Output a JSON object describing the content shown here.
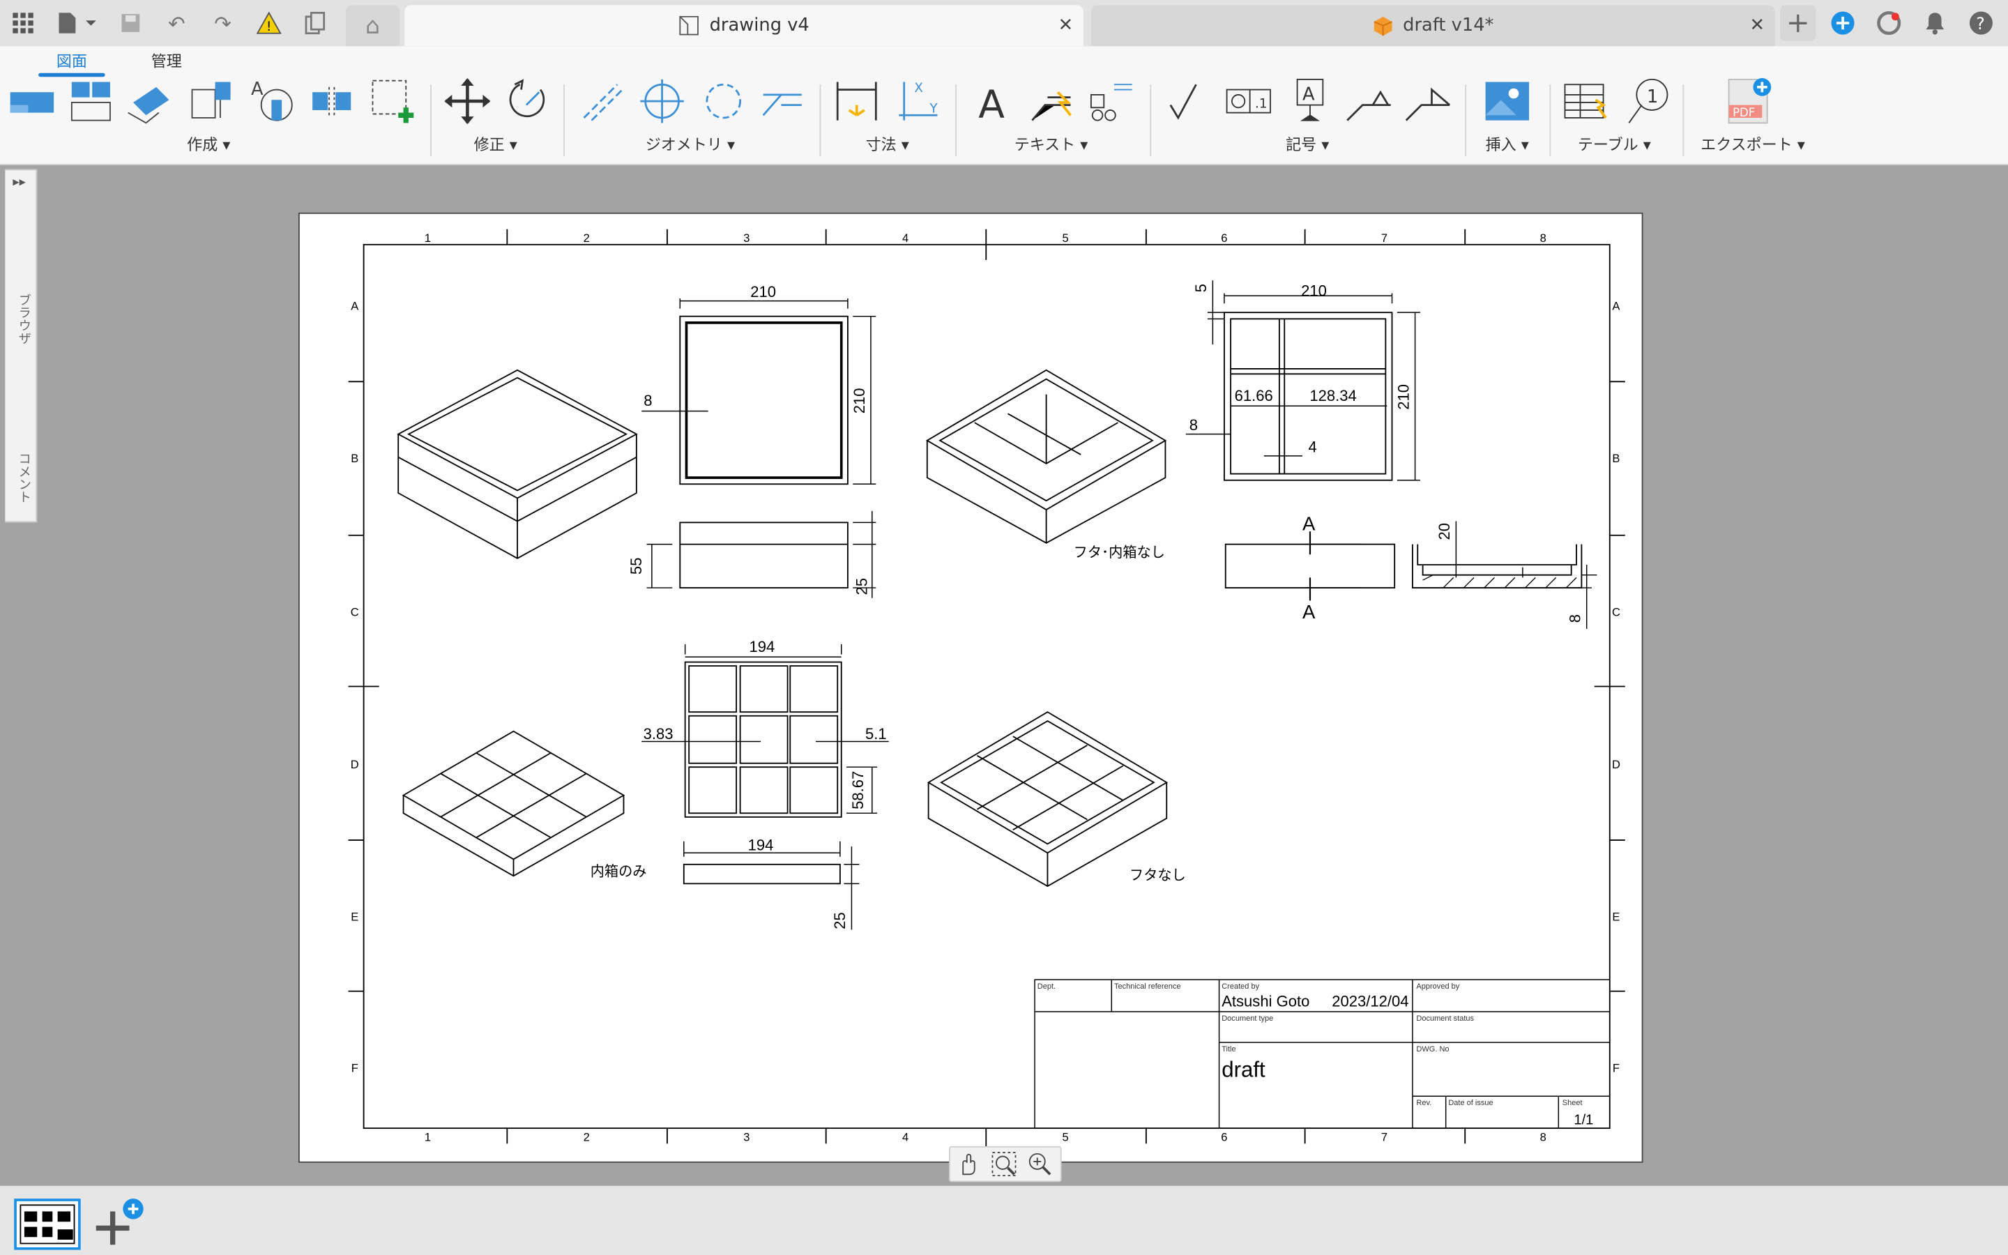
{
  "tabs": [
    {
      "label": "drawing v4",
      "active": true
    },
    {
      "label": "draft v14*",
      "active": false
    }
  ],
  "ribbon": {
    "tabs": [
      "図面",
      "管理"
    ],
    "groups": [
      "作成",
      "修正",
      "ジオメトリ",
      "寸法",
      "テキスト",
      "記号",
      "挿入",
      "テーブル",
      "エクスポート"
    ]
  },
  "browser": {
    "label1": "ブラウザ",
    "label2": "コメント",
    "toggle": "▸▸"
  },
  "sheet": {
    "cols": [
      "1",
      "2",
      "3",
      "4",
      "5",
      "6",
      "7",
      "8"
    ],
    "rows": [
      "A",
      "B",
      "C",
      "D",
      "E",
      "F"
    ],
    "dims": {
      "top_width": "210",
      "top_height": "210",
      "wall": "8",
      "front_h1": "55",
      "front_h2": "25",
      "r_width": "210",
      "r_top": "5",
      "r_height": "210",
      "r_left": "8",
      "r_d1": "61.66",
      "r_d2": "128.34",
      "r_d3": "4",
      "sec_label_top": "A",
      "sec_label_bot": "A",
      "sec_h": "20",
      "sec_w": "8",
      "in_width": "194",
      "in_wall": "3.83",
      "in_gap": "5.1",
      "in_cell": "58.67",
      "in_front_w": "194",
      "in_front_h": "25"
    },
    "labels": {
      "no_lid_inner": "フタ･内箱なし",
      "inner_only": "内箱のみ",
      "no_lid": "フタなし"
    },
    "title_block": {
      "dept": "Dept.",
      "tech_ref": "Technical reference",
      "created_by_lbl": "Created by",
      "approved_by_lbl": "Approved by",
      "created_by": "Atsushi Goto",
      "date": "2023/12/04",
      "doc_type_lbl": "Document type",
      "doc_status_lbl": "Document status",
      "title_lbl": "Title",
      "title": "draft",
      "dwg_lbl": "DWG. No",
      "rev_lbl": "Rev.",
      "issue_lbl": "Date of issue",
      "sheet_lbl": "Sheet",
      "sheet": "1/1"
    }
  },
  "colors": {
    "accent": "#1f7fd4",
    "canvas": "#a3a3a3",
    "ribbon": "#f7f7f7"
  }
}
